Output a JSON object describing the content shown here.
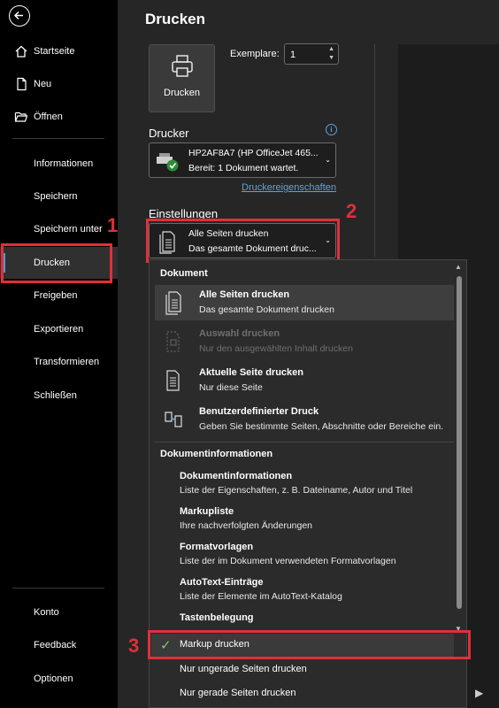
{
  "sidebar": {
    "items": [
      {
        "label": "Startseite",
        "icon": "home-icon"
      },
      {
        "label": "Neu",
        "icon": "new-document-icon"
      },
      {
        "label": "Öffnen",
        "icon": "open-folder-icon"
      },
      {
        "label": "Informationen"
      },
      {
        "label": "Speichern"
      },
      {
        "label": "Speichern unter"
      },
      {
        "label": "Drucken",
        "active": true
      },
      {
        "label": "Freigeben"
      },
      {
        "label": "Exportieren"
      },
      {
        "label": "Transformieren"
      },
      {
        "label": "Schließen"
      }
    ],
    "bottom_items": [
      {
        "label": "Konto"
      },
      {
        "label": "Feedback"
      },
      {
        "label": "Optionen"
      }
    ]
  },
  "annotations": {
    "n1": "1",
    "n2": "2",
    "n3": "3",
    "color": "#e0303a"
  },
  "main": {
    "title": "Drucken",
    "print_button": "Drucken",
    "copies_label": "Exemplare:",
    "copies_value": "1",
    "printer_heading": "Drucker",
    "printer_name": "HP2AF8A7 (HP OfficeJet 465...",
    "printer_status": "Bereit: 1 Dokument wartet.",
    "printer_properties_link": "Druckereigenschaften",
    "settings_heading": "Einstellungen",
    "settings_value": "Alle Seiten drucken",
    "settings_desc": "Das gesamte Dokument druc..."
  },
  "menu": {
    "doc_heading": "Dokument",
    "items": [
      {
        "title": "Alle Seiten drucken",
        "desc": "Das gesamte Dokument drucken",
        "icon": "all-pages-icon",
        "selected": true
      },
      {
        "title": "Auswahl drucken",
        "desc": "Nur den ausgewählten Inhalt drucken",
        "icon": "selection-icon",
        "disabled": true
      },
      {
        "title": "Aktuelle Seite drucken",
        "desc": "Nur diese Seite",
        "icon": "current-page-icon"
      },
      {
        "title": "Benutzerdefinierter Druck",
        "desc": "Geben Sie bestimmte Seiten, Abschnitte oder Bereiche ein.",
        "icon": "custom-print-icon"
      }
    ],
    "info_heading": "Dokumentinformationen",
    "info_items": [
      {
        "title": "Dokumentinformationen",
        "desc": "Liste der Eigenschaften, z. B. Dateiname, Autor und Titel"
      },
      {
        "title": "Markupliste",
        "desc": "Ihre nachverfolgten Änderungen"
      },
      {
        "title": "Formatvorlagen",
        "desc": "Liste der im Dokument verwendeten Formatvorlagen"
      },
      {
        "title": "AutoText-Einträge",
        "desc": "Liste der Elemente im AutoText-Katalog"
      },
      {
        "title": "Tastenbelegung"
      }
    ],
    "markup_print": "Markup drucken",
    "odd_pages": "Nur ungerade Seiten drucken",
    "even_pages": "Nur gerade Seiten drucken"
  }
}
